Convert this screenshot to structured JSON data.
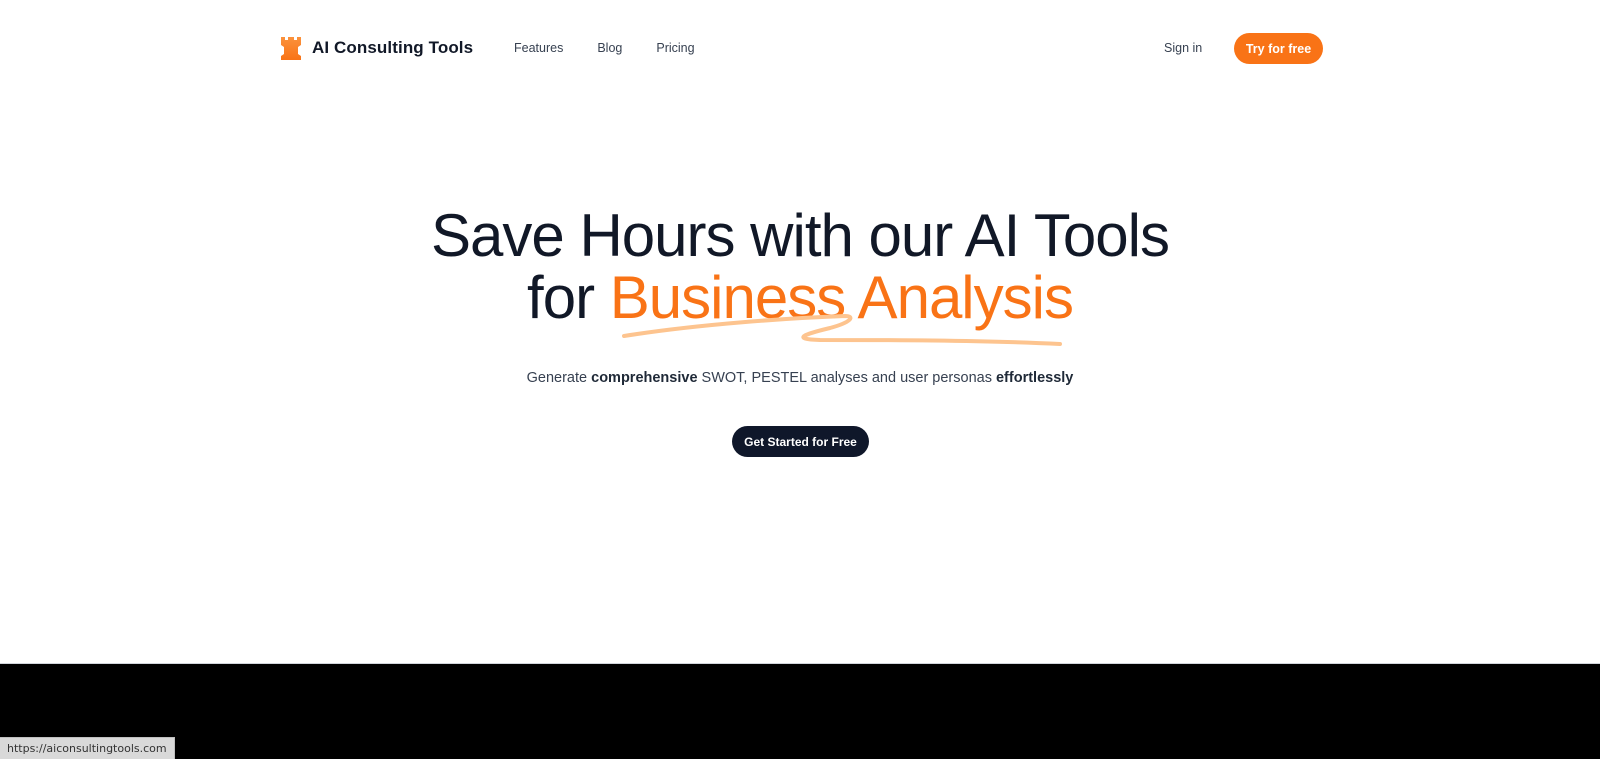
{
  "nav": {
    "brand_name": "AI Consulting Tools",
    "brand_icon": "chess-rook-icon",
    "links": [
      {
        "label": "Features"
      },
      {
        "label": "Blog"
      },
      {
        "label": "Pricing"
      }
    ],
    "signin_label": "Sign in",
    "try_label": "Try for free"
  },
  "hero": {
    "title_line1": "Save Hours with our AI Tools",
    "title_line2_prefix": "for ",
    "title_line2_accent": "Business Analysis",
    "subtitle": {
      "part1": "Generate ",
      "bold1": "comprehensive",
      "part2": " SWOT, PESTEL analyses and user personas ",
      "bold2": "effortlessly"
    },
    "cta_label": "Get Started for Free"
  },
  "status_bar": {
    "url": "https://aiconsultingtools.com"
  },
  "colors": {
    "accent": "#f97316",
    "accent_light": "#fdc48f",
    "dark": "#0f172a",
    "text": "#111827"
  }
}
